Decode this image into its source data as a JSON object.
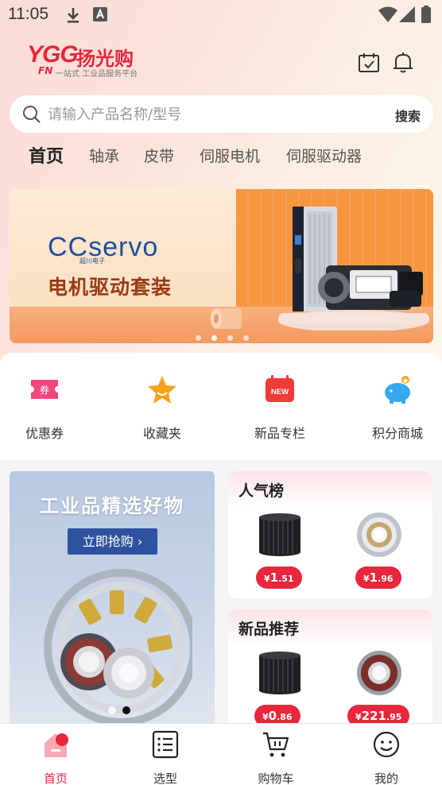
{
  "status_bar": {
    "time": "11:05"
  },
  "header": {
    "logo_mark": "YGG",
    "logo_name": "扬光购",
    "logo_fn": "FN",
    "logo_tagline": "一站式 工业品服务平台"
  },
  "search": {
    "placeholder": "请输入产品名称/型号",
    "button_label": "搜索"
  },
  "tabs": [
    {
      "label": "首页",
      "active": true
    },
    {
      "label": "轴承",
      "active": false
    },
    {
      "label": "皮带",
      "active": false
    },
    {
      "label": "伺服电机",
      "active": false
    },
    {
      "label": "伺服驱动器",
      "active": false
    }
  ],
  "banner": {
    "brand": "CCservo",
    "brand_sub": "超川电子",
    "title": "电机驱动套装",
    "slide_count": 4,
    "active_slide": 2
  },
  "quick_menu": [
    {
      "label": "优惠券",
      "icon": "coupon-icon",
      "color": "#f2477d"
    },
    {
      "label": "收藏夹",
      "icon": "star-icon",
      "color": "#f7a21b"
    },
    {
      "label": "新品专栏",
      "icon": "new-badge-icon",
      "color": "#ef3b3b"
    },
    {
      "label": "积分商城",
      "icon": "piggy-bank-icon",
      "color": "#36a8f0"
    }
  ],
  "promo": {
    "title": "工业品精选好物",
    "button_label": "立即抢购",
    "slide_count": 2,
    "active_slide": 2
  },
  "popular": {
    "title": "人气榜",
    "products": [
      {
        "currency": "¥",
        "integer": "1",
        "decimal": ".51",
        "image": "timing-belt"
      },
      {
        "currency": "¥",
        "integer": "1",
        "decimal": ".96",
        "image": "ball-bearing"
      }
    ]
  },
  "new_recommend": {
    "title": "新品推荐",
    "products": [
      {
        "currency": "¥",
        "integer": "0",
        "decimal": ".86",
        "image": "timing-belt"
      },
      {
        "currency": "¥",
        "integer": "221",
        "decimal": ".95",
        "image": "sealed-bearing"
      }
    ]
  },
  "bottom_nav": [
    {
      "label": "首页",
      "icon": "home-icon",
      "active": true
    },
    {
      "label": "选型",
      "icon": "list-icon",
      "active": false
    },
    {
      "label": "购物车",
      "icon": "cart-icon",
      "active": false
    },
    {
      "label": "我的",
      "icon": "profile-icon",
      "active": false
    }
  ],
  "colors": {
    "accent": "#e8263c",
    "promo_button": "#2f52a0"
  }
}
